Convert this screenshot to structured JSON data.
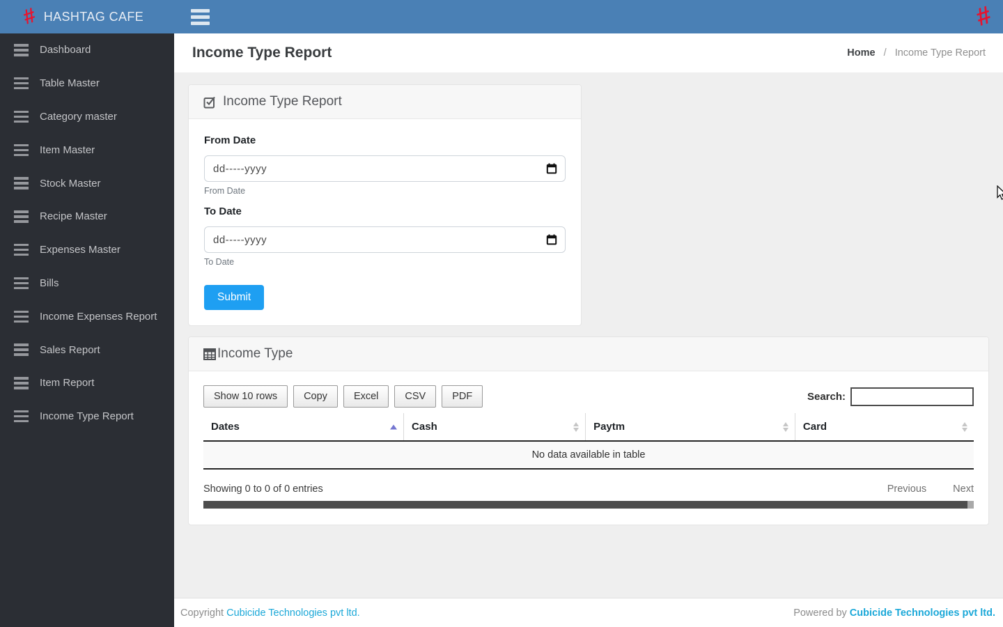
{
  "topbar": {
    "brand": "HASHTAG CAFE",
    "logo_glyph": "#"
  },
  "sidebar": {
    "items": [
      {
        "label": "Dashboard"
      },
      {
        "label": "Table Master"
      },
      {
        "label": "Category master"
      },
      {
        "label": "Item Master"
      },
      {
        "label": "Stock Master"
      },
      {
        "label": "Recipe Master"
      },
      {
        "label": "Expenses Master"
      },
      {
        "label": "Bills"
      },
      {
        "label": "Income Expenses Report"
      },
      {
        "label": "Sales Report"
      },
      {
        "label": "Item Report"
      },
      {
        "label": "Income Type Report"
      }
    ]
  },
  "header": {
    "title": "Income Type Report",
    "breadcrumb": {
      "home": "Home",
      "separator": "/",
      "current": "Income Type Report"
    }
  },
  "filter_card": {
    "title": "Income Type Report",
    "from": {
      "label": "From Date",
      "placeholder": "dd-----yyyy",
      "helper": "From Date"
    },
    "to": {
      "label": "To Date",
      "placeholder": "dd-----yyyy",
      "helper": "To Date"
    },
    "submit_label": "Submit"
  },
  "table_card": {
    "title": "Income Type",
    "buttons": [
      "Show 10 rows",
      "Copy",
      "Excel",
      "CSV",
      "PDF"
    ],
    "search_label": "Search:",
    "search_value": "",
    "columns": [
      "Dates",
      "Cash",
      "Paytm",
      "Card"
    ],
    "sorted_column": "Dates",
    "sort_direction": "asc",
    "empty_message": "No data available in table",
    "info_text": "Showing 0 to 0 of 0 entries",
    "pagination": {
      "previous": "Previous",
      "next": "Next"
    }
  },
  "footer": {
    "copyright_prefix": "Copyright ",
    "copyright_link": "Cubicide Technologies pvt ltd.",
    "powered_prefix": "Powered by ",
    "powered_link": "Cubicide Technologies pvt ltd."
  },
  "colors": {
    "topbar_blue": "#4a80b5",
    "sidebar_dark": "#2b2e34",
    "logo_red": "#e8132e",
    "accent_blue": "#1e9ff2",
    "link_blue": "#1ba8d8",
    "sort_active": "#7577d1",
    "content_bg": "#efefef"
  }
}
